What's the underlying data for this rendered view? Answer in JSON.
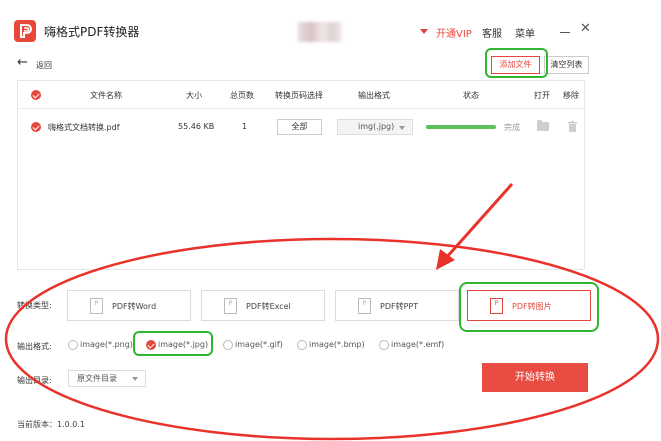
{
  "app": {
    "title": "嗨格式PDF转换器"
  },
  "header": {
    "vip_label": "开通VIP",
    "service_label": "客服",
    "menu_label": "菜单"
  },
  "toolbar": {
    "back_label": "返回",
    "add_file_label": "添加文件",
    "clear_list_label": "清空列表"
  },
  "table": {
    "columns": [
      "文件名称",
      "大小",
      "总页数",
      "转换页码选择",
      "输出格式",
      "状态",
      "打开",
      "移除"
    ],
    "rows": [
      {
        "name": "嗨格式文档转换.pdf",
        "size": "55.46 KB",
        "pages": "1",
        "page_select": "全部",
        "format": "img(.jpg)",
        "progress": 1.0,
        "status": "完成"
      }
    ]
  },
  "options": {
    "type_label": "转换类型:",
    "types": [
      {
        "label": "PDF转Word",
        "icon": "pdf-doc-icon"
      },
      {
        "label": "PDF转Excel",
        "icon": "pdf-doc-icon"
      },
      {
        "label": "PDF转PPT",
        "icon": "pdf-doc-icon"
      },
      {
        "label": "PDF转图片",
        "icon": "pdf-image-icon",
        "selected": true
      }
    ],
    "format_label": "输出格式:",
    "formats": [
      "image(*.png)",
      "image(*.jpg)",
      "image(*.gif)",
      "image(*.bmp)",
      "image(*.emf)"
    ],
    "selected_format": "image(*.jpg)",
    "dir_label": "输出目录:",
    "dir_value": "原文件目录",
    "start_label": "开始转换"
  },
  "footer": {
    "version": "当前版本：1.0.0.1"
  },
  "colors": {
    "accent": "#e4473d",
    "annotation_red": "#e8322a",
    "annotation_green": "#31b631",
    "progress": "#5cc05c"
  }
}
